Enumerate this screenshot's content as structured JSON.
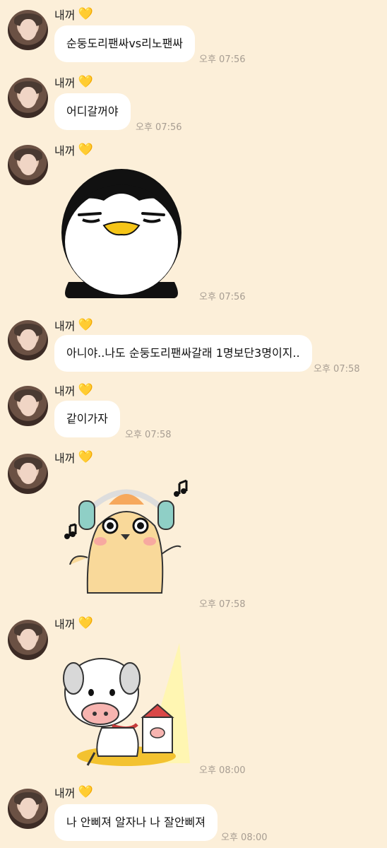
{
  "sender": {
    "name": "내꺼",
    "heart": "💛"
  },
  "messages": [
    {
      "type": "text",
      "text": "순둥도리팬싸vs리노팬싸",
      "time": "오후 07:56"
    },
    {
      "type": "text",
      "text": "어디갈꺼야",
      "time": "오후 07:56"
    },
    {
      "type": "sticker",
      "sticker": "penguin-sticker",
      "time": "오후 07:56"
    },
    {
      "type": "text",
      "text": "아니야..나도 순둥도리팬싸갈래 1명보단3명이지..",
      "time": "오후 07:58"
    },
    {
      "type": "text",
      "text": "같이가자",
      "time": "오후 07:58"
    },
    {
      "type": "sticker",
      "sticker": "hamster-headphones-sticker",
      "time": "오후 07:58"
    },
    {
      "type": "sticker",
      "sticker": "pig-milk-sticker",
      "time": "오후 08:00"
    },
    {
      "type": "text",
      "text": "나 안삐져 알자나 나 잘안삐져",
      "time": "오후 08:00"
    }
  ],
  "colors": {
    "background": "#fcefd9",
    "bubble": "#ffffff",
    "time": "#a79d92"
  }
}
